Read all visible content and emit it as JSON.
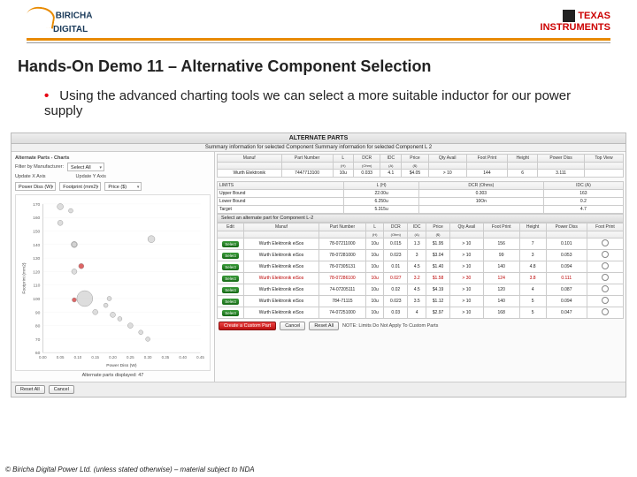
{
  "logos": {
    "biricha_top": "BIRICHA",
    "biricha_bottom": "DIGITAL",
    "ti_top": "TEXAS",
    "ti_bottom": "INSTRUMENTS"
  },
  "title": "Hands-On Demo 11 – Alternative Component Selection",
  "bullet": "Using the advanced charting tools we can select a more suitable inductor for our power supply",
  "app": {
    "window_title": "ALTERNATE PARTS",
    "subtitle": "Summary information for selected Component Summary information for selected Component L 2",
    "left": {
      "section_label": "Alternate Parts - Charts",
      "filter_label": "Filter by Manufacturer:",
      "filter_value": "Select All",
      "update_x": "Update X Axis",
      "update_y": "Update Y Axis",
      "axis1": "Power Diss (W)",
      "axis2": "Footprint (mm2)",
      "axis3": "Price ($)",
      "y_ticks": [
        "170",
        "160",
        "150",
        "140",
        "130",
        "120",
        "110",
        "100",
        "90",
        "80",
        "70",
        "60"
      ],
      "x_ticks": [
        "0.00",
        "0.05",
        "0.10",
        "0.15",
        "0.20",
        "0.25",
        "0.30",
        "0.35",
        "0.40",
        "0.45"
      ],
      "x_axis_label": "Power Diss (W)",
      "y_axis_label": "Footprint (mm2)",
      "disp_label": "Alternate parts displayed: 47",
      "reset": "Reset All",
      "cancel": "Cancel"
    },
    "summary": {
      "headers": [
        "Manuf",
        "Part Number",
        "L",
        "DCR",
        "IDC",
        "Price",
        "Qty Avail",
        "Foot Print",
        "Height",
        "Power Diss",
        "Top View"
      ],
      "sub": [
        "",
        "",
        "(H)",
        "(Ohm)",
        "(A)",
        "($)",
        "",
        "",
        "",
        "",
        ""
      ],
      "row": [
        "Wurth Elektronik",
        "7447713100",
        "10u",
        "0.033",
        "4.1",
        "$4.05",
        "> 10",
        "144",
        "6",
        "3.111",
        ""
      ]
    },
    "limits": {
      "title": "LIMITS",
      "headers": [
        "L (H)",
        "DCR (Ohms)",
        "IDC (A)"
      ],
      "rows": [
        {
          "label": "Upper Bound",
          "v": [
            "22.00u",
            "0.303",
            "163"
          ]
        },
        {
          "label": "Lower Bound",
          "v": [
            "6.250u",
            "10On",
            "0.2"
          ]
        },
        {
          "label": "Target",
          "v": [
            "5.315u",
            "",
            "4.7"
          ]
        }
      ]
    },
    "alt_label": "Select an alternate part for Component L-2",
    "alt": {
      "headers": [
        "Edit",
        "Manuf",
        "Part Number",
        "L",
        "DCR",
        "IDC",
        "Price",
        "Qty Avail",
        "Foot Print",
        "Height",
        "Power Diss",
        "Foot Print"
      ],
      "sub": [
        "",
        "",
        "",
        "(H)",
        "(Ohm)",
        "(A)",
        "($)",
        "",
        "",
        "",
        "",
        ""
      ],
      "rows": [
        {
          "m": "Wurth Elektronik eiSos",
          "pn": "78-07211000",
          "l": "10u",
          "dcr": "0.015",
          "idc": "1.3",
          "price": "$1.95",
          "qty": "> 10",
          "fp": "156",
          "h": "7",
          "pd": "0.101",
          "hl": false
        },
        {
          "m": "Wurth Elektronik eiSos",
          "pn": "78-07281000",
          "l": "10u",
          "dcr": "0.023",
          "idc": "3",
          "price": "$3.04",
          "qty": "> 10",
          "fp": "99",
          "h": "3",
          "pd": "0.053",
          "hl": false
        },
        {
          "m": "Wurth Elektronik eiSos",
          "pn": "78-07305131",
          "l": "10u",
          "dcr": "0.01",
          "idc": "4.5",
          "price": "$1.40",
          "qty": "> 10",
          "fp": "140",
          "h": "4.8",
          "pd": "0.094",
          "hl": false
        },
        {
          "m": "Wurth Elektronik eiSos",
          "pn": "78-07286100",
          "l": "10u",
          "dcr": "0.027",
          "idc": "3.2",
          "price": "$1.58",
          "qty": "> 30",
          "fp": "124",
          "h": "3.8",
          "pd": "0.111",
          "hl": true
        },
        {
          "m": "Wurth Elektronik eiSos",
          "pn": "74-07205111",
          "l": "10u",
          "dcr": "0.02",
          "idc": "4.5",
          "price": "$4.19",
          "qty": "> 10",
          "fp": "120",
          "h": "4",
          "pd": "0.087",
          "hl": false
        },
        {
          "m": "Wurth Elektronik eiSos",
          "pn": "784-71115",
          "l": "10u",
          "dcr": "0.023",
          "idc": "3.5",
          "price": "$1.12",
          "qty": "> 10",
          "fp": "140",
          "h": "5",
          "pd": "0.094",
          "hl": false
        },
        {
          "m": "Wurth Elektronik eiSos",
          "pn": "74-07251000",
          "l": "10u",
          "dcr": "0.03",
          "idc": "4",
          "price": "$2.97",
          "qty": "> 10",
          "fp": "168",
          "h": "5",
          "pd": "0.047",
          "hl": false
        }
      ],
      "select_label": "Select"
    },
    "bottom": {
      "create": "Create a Custom Part",
      "cancel": "Cancel",
      "reset": "Reset All",
      "note": "NOTE: Limits Do Not Apply To Custom Parts"
    }
  },
  "copyright": "© Biricha Digital Power Ltd. (unless stated otherwise) – material subject to NDA",
  "chart_data": {
    "type": "scatter",
    "xlabel": "Power Diss (W)",
    "ylabel": "Footprint (mm2)",
    "xlim": [
      0,
      0.45
    ],
    "ylim": [
      60,
      170
    ],
    "points": [
      {
        "x": 0.05,
        "y": 156,
        "size": 6
      },
      {
        "x": 0.09,
        "y": 99,
        "size": 5,
        "highlight": true
      },
      {
        "x": 0.09,
        "y": 140,
        "size": 7
      },
      {
        "x": 0.11,
        "y": 124,
        "size": 6,
        "highlight": true
      },
      {
        "x": 0.09,
        "y": 120,
        "size": 6
      },
      {
        "x": 0.09,
        "y": 140,
        "size": 6
      },
      {
        "x": 0.05,
        "y": 168,
        "size": 7
      },
      {
        "x": 0.12,
        "y": 100,
        "size": 18
      },
      {
        "x": 0.15,
        "y": 90,
        "size": 6
      },
      {
        "x": 0.18,
        "y": 95,
        "size": 5
      },
      {
        "x": 0.2,
        "y": 88,
        "size": 6
      },
      {
        "x": 0.22,
        "y": 85,
        "size": 5
      },
      {
        "x": 0.25,
        "y": 80,
        "size": 6
      },
      {
        "x": 0.28,
        "y": 75,
        "size": 5
      },
      {
        "x": 0.31,
        "y": 144,
        "size": 8
      },
      {
        "x": 0.3,
        "y": 70,
        "size": 5
      },
      {
        "x": 0.08,
        "y": 165,
        "size": 5
      },
      {
        "x": 0.19,
        "y": 100,
        "size": 5
      }
    ]
  }
}
